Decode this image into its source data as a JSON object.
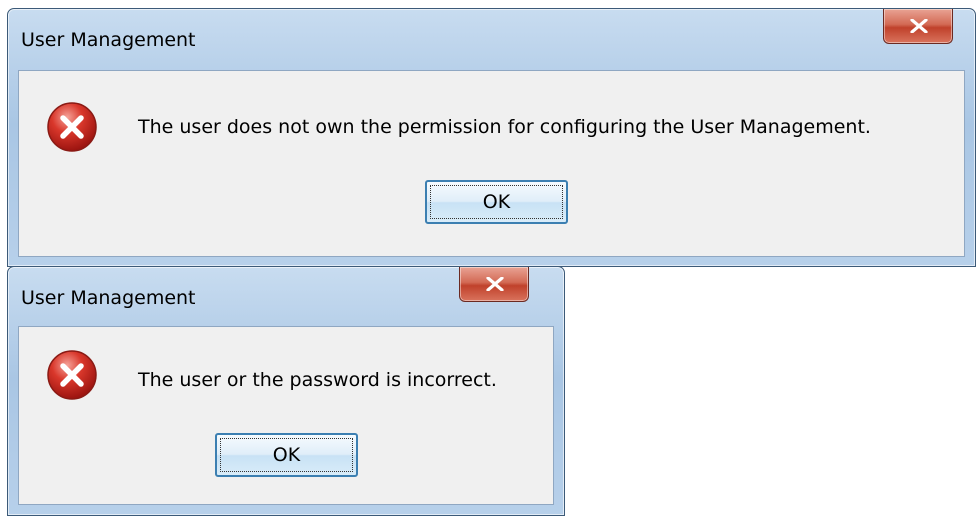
{
  "dialogs": [
    {
      "title": "User Management",
      "close_icon": "close-x-icon",
      "status_icon": "error-icon",
      "message": "The user does not own the permission for configuring the User Management.",
      "ok_label": "OK"
    },
    {
      "title": "User Management",
      "close_icon": "close-x-icon",
      "status_icon": "error-icon",
      "message": "The user or the password is incorrect.",
      "ok_label": "OK"
    }
  ],
  "colors": {
    "error_red": "#c8281e",
    "close_button_red": "#c0412b",
    "titlebar_blue": "#b7d0ea",
    "client_gray": "#f0f0f0",
    "focus_border_blue": "#3c7fb1"
  }
}
